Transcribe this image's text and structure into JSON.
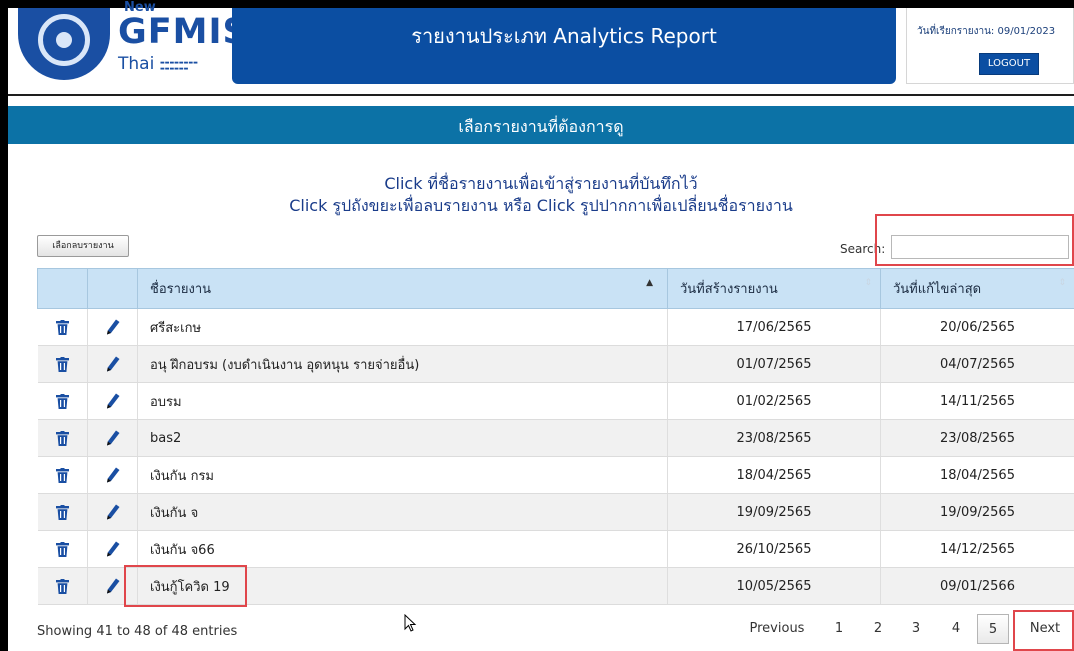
{
  "logo": {
    "prefix": "New",
    "name": "GFMIS",
    "suffix": "Thai"
  },
  "header": {
    "title": "รายงานประเภท Analytics Report"
  },
  "user_info": {
    "search_date": "วันที่เรียกรายงาน: 09/01/2023",
    "logout_label": "LOGOUT"
  },
  "section": {
    "title": "เลือกรายงานที่ต้องการดู"
  },
  "instructions": {
    "line1": "Click ที่ชื่อรายงานเพื่อเข้าสู่รายงานที่บันทึกไว้",
    "line2": "Click รูปถังขยะเพื่อลบรายงาน หรือ Click รูปปากกาเพื่อเปลี่ยนชื่อรายงาน"
  },
  "toolbar": {
    "delete_selected_label": "เลือกลบรายงาน",
    "search_label": "Search:",
    "search_value": ""
  },
  "table": {
    "columns": [
      "",
      "",
      "ชื่อรายงาน",
      "วันที่สร้างรายงาน",
      "วันที่แก้ไขล่าสุด"
    ],
    "rows": [
      {
        "name": "ศรีสะเกษ",
        "created": "17/06/2565",
        "modified": "20/06/2565"
      },
      {
        "name": "อนุ ฝึกอบรม (งบดำเนินงาน อุดหนุน รายจ่ายอื่น)",
        "created": "01/07/2565",
        "modified": "04/07/2565"
      },
      {
        "name": "อบรม",
        "created": "01/02/2565",
        "modified": "14/11/2565"
      },
      {
        "name": "bas2",
        "created": "23/08/2565",
        "modified": "23/08/2565"
      },
      {
        "name": "เงินกัน กรม",
        "created": "18/04/2565",
        "modified": "18/04/2565"
      },
      {
        "name": "เงินกัน จ",
        "created": "19/09/2565",
        "modified": "19/09/2565"
      },
      {
        "name": "เงินกัน จ66",
        "created": "26/10/2565",
        "modified": "14/12/2565"
      },
      {
        "name": "เงินกู้โควิด 19",
        "created": "10/05/2565",
        "modified": "09/01/2566"
      }
    ]
  },
  "pagination": {
    "info": "Showing 41 to 48 of 48 entries",
    "previous": "Previous",
    "pages": [
      "1",
      "2",
      "3",
      "4",
      "5"
    ],
    "next": "Next",
    "current": "5"
  },
  "colors": {
    "header_blue": "#0b4ea2",
    "section_blue": "#0c72a6",
    "highlight_red": "#e0464b",
    "table_header": "#c9e2f5"
  }
}
